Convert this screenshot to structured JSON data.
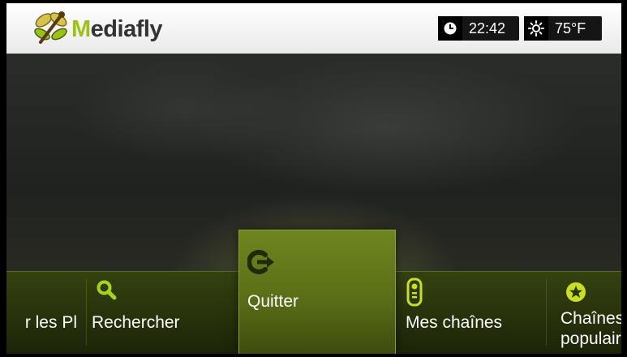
{
  "header": {
    "logo": {
      "text_highlight": "M",
      "text_rest": "ediafly"
    },
    "clock": {
      "icon": "clock-icon",
      "time": "22:42"
    },
    "weather": {
      "icon": "sun-icon",
      "temperature": "75°F"
    }
  },
  "menu": {
    "items": [
      {
        "label": "r les Pl",
        "icon": ""
      },
      {
        "label": "Rechercher",
        "icon": "search-icon"
      },
      {
        "label": "Quitter",
        "icon": "exit-icon",
        "selected": true
      },
      {
        "label": "Mes chaînes",
        "icon": "remote-icon"
      },
      {
        "label_line1": "Chaînes",
        "label_line2": "populair",
        "icon": "star-icon"
      }
    ]
  },
  "colors": {
    "accent": "#9bc214",
    "menu_bg": "#2b370c",
    "selected_bg": "#5a6e17",
    "header_bg": "#ffffff"
  }
}
